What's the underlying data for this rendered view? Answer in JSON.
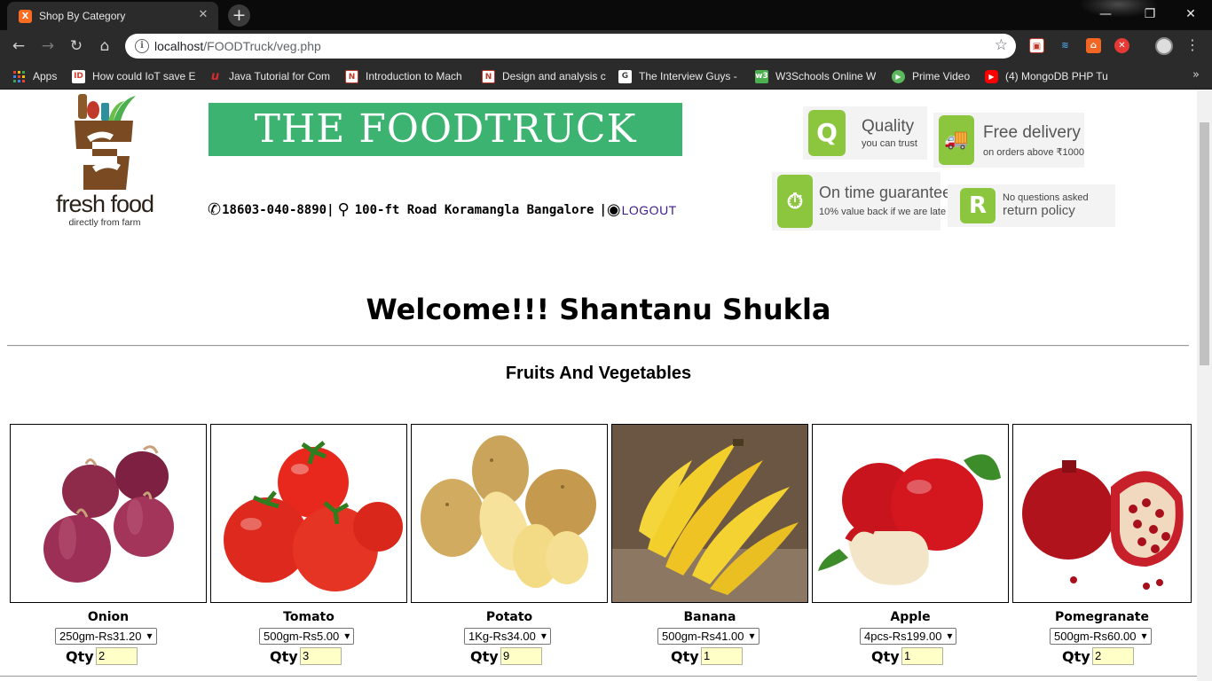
{
  "browser": {
    "tab_title": "Shop By Category",
    "tab_favicon": "X",
    "url_host": "localhost",
    "url_path": "/FOODTruck/veg.php",
    "bookmarks": [
      {
        "label": "Apps",
        "icon": "apps-grid-icon"
      },
      {
        "label": "How could IoT save E",
        "icon": "ID",
        "color": "#e03a2f"
      },
      {
        "label": "Java Tutorial for Com",
        "icon": "u",
        "color": "#d62c2c"
      },
      {
        "label": "Introduction to Mach",
        "icon": "N",
        "color": "#c0392b"
      },
      {
        "label": "Design and analysis c",
        "icon": "N",
        "color": "#c0392b"
      },
      {
        "label": "The Interview Guys -",
        "icon": "G",
        "color": "#444444"
      },
      {
        "label": "W3Schools Online W",
        "icon": "w3",
        "color": "#4caf50"
      },
      {
        "label": "Prime Video",
        "icon": "▶",
        "color": "#5cb85c"
      },
      {
        "label": "(4) MongoDB PHP Tu",
        "icon": "▶",
        "color": "#ff0000"
      }
    ]
  },
  "header": {
    "banner": "THE FOODTRUCK",
    "logo_text": "fresh food",
    "logo_sub": "directly from farm",
    "phone": "18603-040-8890",
    "address": "100-ft Road Koramangla Bangalore",
    "logout": "LOGOUT"
  },
  "badges": [
    {
      "icon": "Q",
      "title": "Quality",
      "sub": "you can trust"
    },
    {
      "icon": "truck",
      "title": "Free delivery",
      "sub": "on orders above ₹1000"
    },
    {
      "icon": "timer",
      "title": "On time guarantee",
      "sub": "10% value back if we are late"
    },
    {
      "icon": "R",
      "title": "No questions asked",
      "sub": "return policy"
    }
  ],
  "main": {
    "welcome": "Welcome!!! Shantanu Shukla",
    "section_title": "Fruits And Vegetables",
    "qty_label": "Qty",
    "products": [
      {
        "name": "Onion",
        "option": "250gm-Rs31.20",
        "qty": "2"
      },
      {
        "name": "Tomato",
        "option": "500gm-Rs5.00",
        "qty": "3"
      },
      {
        "name": "Potato",
        "option": "1Kg-Rs34.00",
        "qty": "9"
      },
      {
        "name": "Banana",
        "option": "500gm-Rs41.00",
        "qty": "1"
      },
      {
        "name": "Apple",
        "option": "4pcs-Rs199.00",
        "qty": "1"
      },
      {
        "name": "Pomegranate",
        "option": "500gm-Rs60.00",
        "qty": "2"
      }
    ]
  }
}
